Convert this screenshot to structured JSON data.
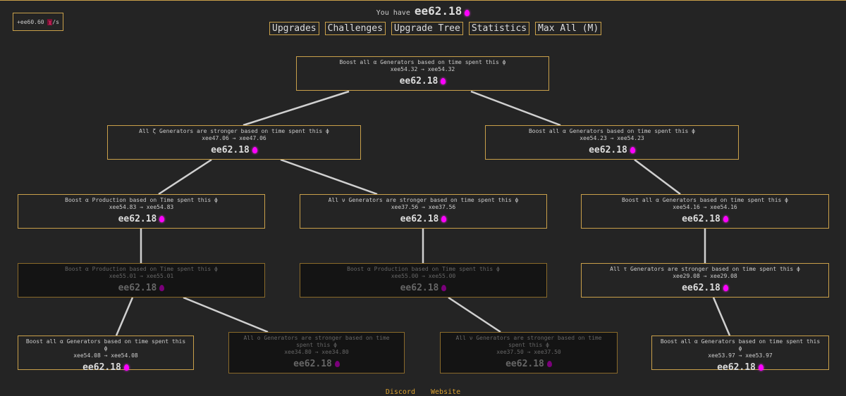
{
  "header": {
    "rate": "+ee60.60",
    "rate_unit": "χ",
    "rate_suffix": "/s",
    "have_label": "You have",
    "have_amount": "ee62.18"
  },
  "tabs": [
    "Upgrades",
    "Challenges",
    "Upgrade Tree",
    "Statistics",
    "Max All (M)"
  ],
  "nodes": [
    {
      "title": "Boost all α Generators based on time spent this ϕ",
      "effect": "xee54.32 → xee54.32",
      "cost": "ee62.18",
      "locked": false
    },
    {
      "title": "All ζ Generators are stronger based on time spent this ϕ",
      "effect": "xee47.06 → xee47.06",
      "cost": "ee62.18",
      "locked": false
    },
    {
      "title": "Boost all α Generators based on time spent this ϕ",
      "effect": "xee54.23 → xee54.23",
      "cost": "ee62.18",
      "locked": false
    },
    {
      "title": "Boost α Production based on Time spent this ϕ",
      "effect": "xee54.83 → xee54.83",
      "cost": "ee62.18",
      "locked": false
    },
    {
      "title": "All ν Generators are stronger based on time spent this ϕ",
      "effect": "xee37.56 → xee37.56",
      "cost": "ee62.18",
      "locked": false
    },
    {
      "title": "Boost all α Generators based on time spent this ϕ",
      "effect": "xee54.16 → xee54.16",
      "cost": "ee62.18",
      "locked": false
    },
    {
      "title": "Boost α Production based on Time spent this ϕ",
      "effect": "xee55.01 → xee55.01",
      "cost": "ee62.18",
      "locked": true
    },
    {
      "title": "Boost α Production based on Time spent this ϕ",
      "effect": "xee55.00 → xee55.00",
      "cost": "ee62.18",
      "locked": true
    },
    {
      "title": "All τ Generators are stronger based on time spent this ϕ",
      "effect": "xee29.08 → xee29.08",
      "cost": "ee62.18",
      "locked": false
    },
    {
      "title": "Boost all α Generators based on time spent this ϕ",
      "effect": "xee54.08 → xee54.08",
      "cost": "ee62.18",
      "locked": false
    },
    {
      "title": "All ο Generators are stronger based on time spent this ϕ",
      "effect": "xee34.80 → xee34.80",
      "cost": "ee62.18",
      "locked": true
    },
    {
      "title": "All ν Generators are stronger based on time spent this ϕ",
      "effect": "xee37.50 → xee37.50",
      "cost": "ee62.18",
      "locked": true
    },
    {
      "title": "Boost all α Generators based on time spent this ϕ",
      "effect": "xee53.97 → xee53.97",
      "cost": "ee62.18",
      "locked": false
    }
  ],
  "footer": {
    "discord": "Discord",
    "website": "Website"
  }
}
